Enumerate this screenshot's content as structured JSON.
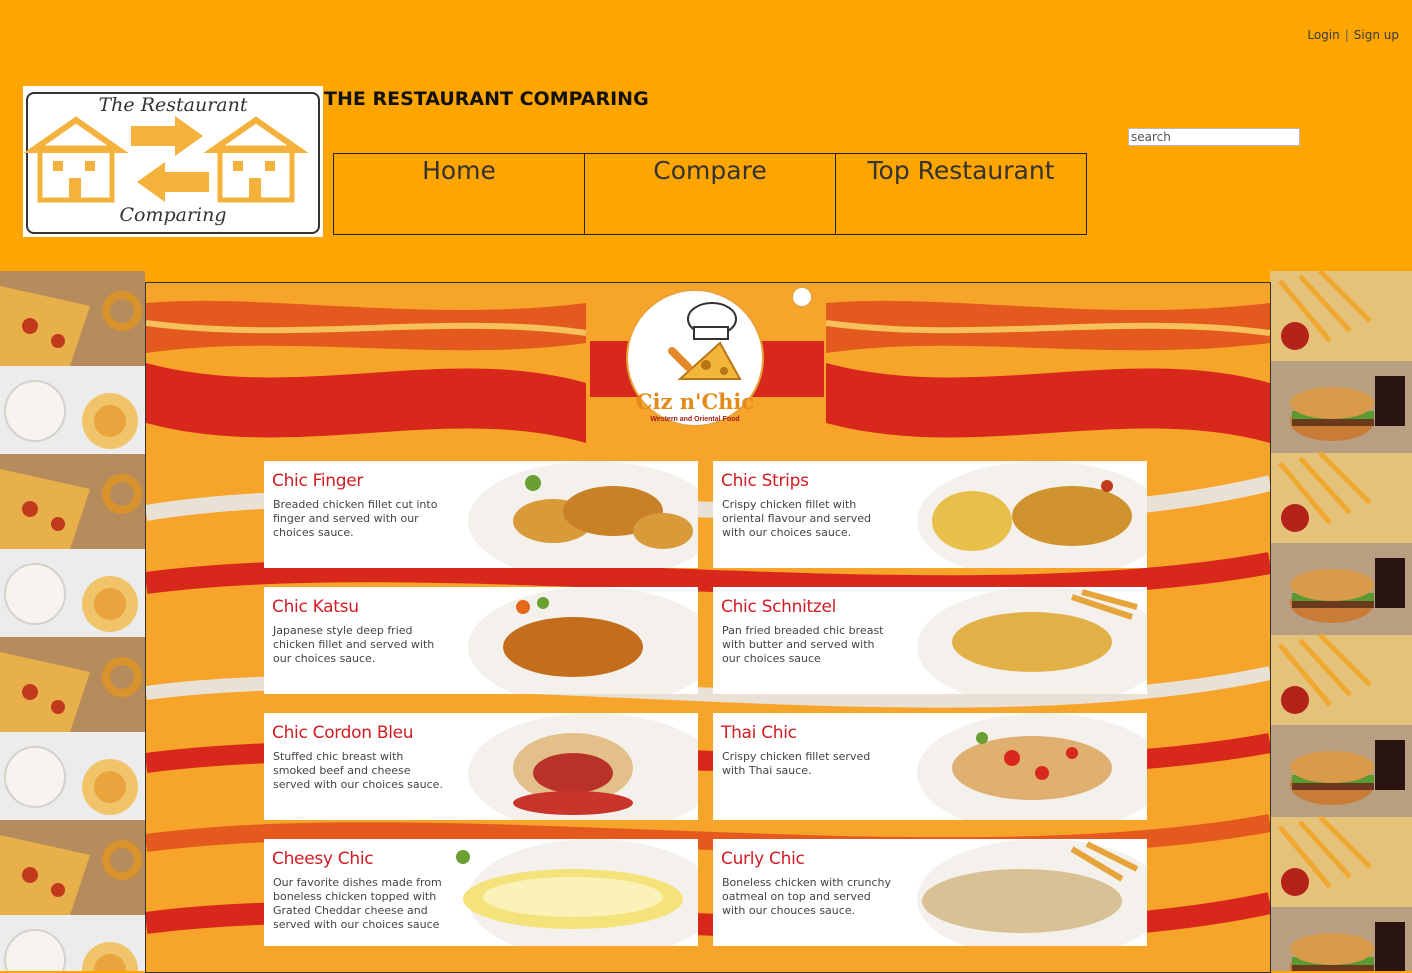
{
  "header": {
    "auth": {
      "login": "Login",
      "separator": "|",
      "signup": "Sign up"
    },
    "logo": {
      "line1": "The Restaurant",
      "line2": "Comparing"
    },
    "site_title": "THE RESTAURANT COMPARING",
    "nav": [
      {
        "label": "Home"
      },
      {
        "label": "Compare"
      },
      {
        "label": "Top Restaurant"
      }
    ],
    "search": {
      "placeholder": "search",
      "value": ""
    }
  },
  "restaurant": {
    "brand_name": "Ciz n'Chic",
    "brand_tagline": "Western and Oriental Food",
    "menu": [
      {
        "name": "Chic Finger",
        "description": "Breaded chicken fillet cut into finger and served with our choices sauce."
      },
      {
        "name": "Chic Strips",
        "description": "Crispy chicken fillet with oriental flavour and served with our choices sauce."
      },
      {
        "name": "Chic Katsu",
        "description": "Japanese style deep fried chicken fillet and served with our choices sauce."
      },
      {
        "name": "Chic Schnitzel",
        "description": "Pan fried breaded chic breast with butter and served with our choices sauce"
      },
      {
        "name": "Chic Cordon Bleu",
        "description": "Stuffed chic breast with smoked beef and cheese served with our choices sauce."
      },
      {
        "name": "Thai Chic",
        "description": "Crispy chicken fillet served with Thai sauce."
      },
      {
        "name": "Cheesy Chic",
        "description": "Our favorite dishes made from boneless chicken topped with Grated Cheddar cheese and served with our choices sauce"
      },
      {
        "name": "Curly Chic",
        "description": "Boneless chicken with crunchy oatmeal on top and served with our chouces sauce."
      }
    ]
  },
  "colors": {
    "header_bg": "#ffa500",
    "menu_title": "#d01c22",
    "panel_bg": "#f7a42a",
    "stripe_red": "#d8281c"
  }
}
